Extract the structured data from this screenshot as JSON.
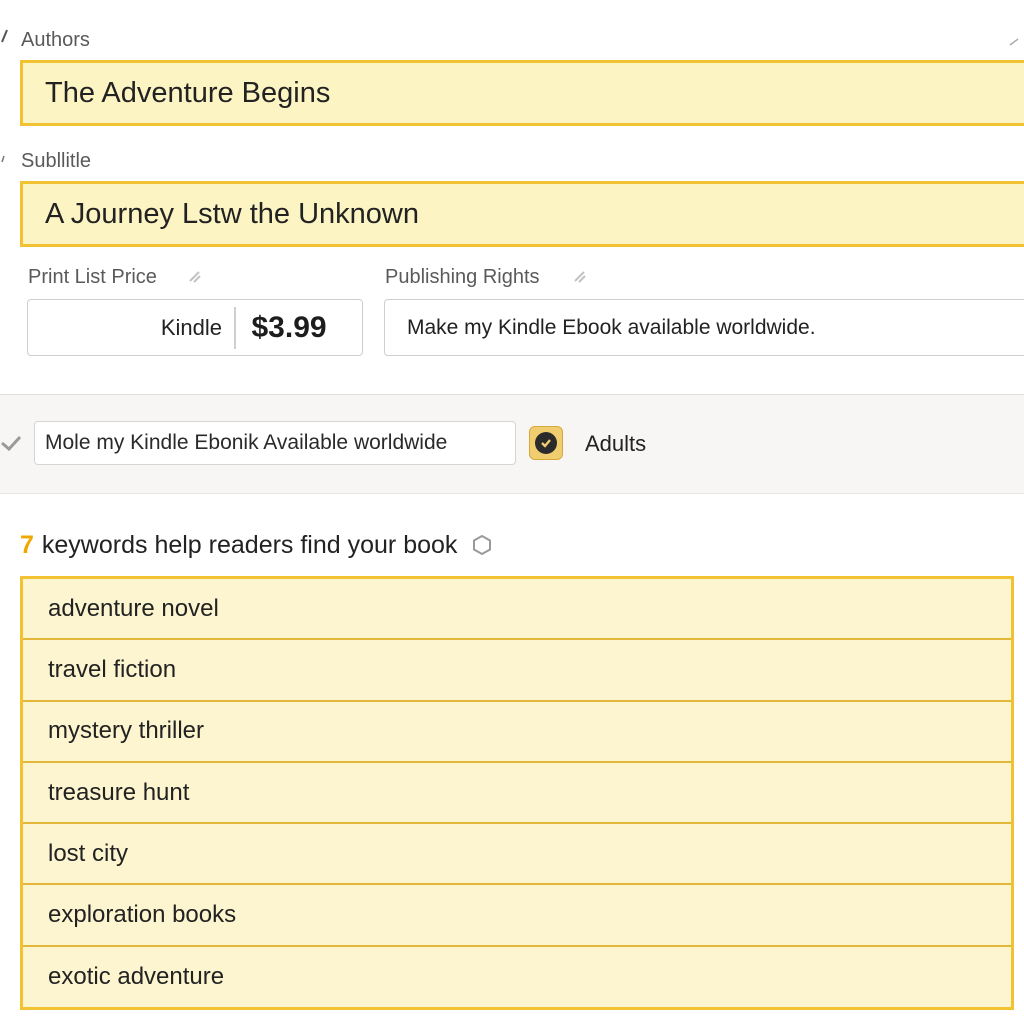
{
  "authors": {
    "label": "Authors",
    "value": "The Adventure Begins"
  },
  "subtitle": {
    "label": "Subllitle",
    "value": "A Journey Lstw the Unknown"
  },
  "price": {
    "label": "Print List Price",
    "format": "Kindle",
    "value": "$3.99"
  },
  "rights": {
    "label": "Publishing Rights",
    "value": "Make my Kindle Ebook available worldwide."
  },
  "availability": {
    "input_value": "Mole my Kindle Ebonik Available worldwide",
    "checkbox_label": "Adults",
    "checked": true
  },
  "keywords": {
    "count": "7",
    "heading": "keywords help readers find your book",
    "items": [
      "adventure novel",
      "travel fiction",
      "mystery thriller",
      "treasure hunt",
      "lost city",
      "exploration books",
      "exotic adventure"
    ]
  },
  "colors": {
    "accent_yellow": "#f1c232",
    "field_fill": "#fdf4c4",
    "count_orange": "#f0a800"
  },
  "icons": [
    "pencil-icon",
    "info-icon",
    "chevron-left-icon",
    "checkmark-icon",
    "help-icon"
  ]
}
